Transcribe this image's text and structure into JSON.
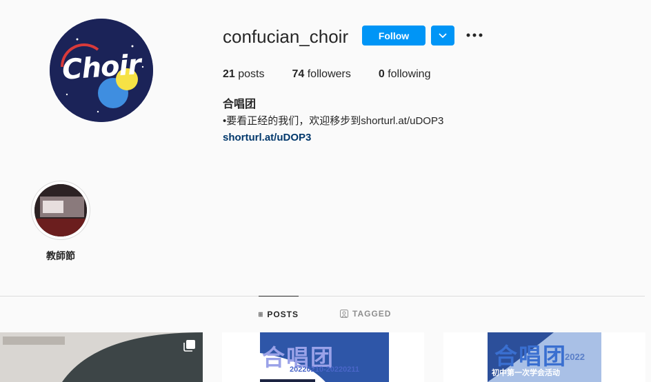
{
  "profile": {
    "avatar_text": "Choir",
    "username": "confucian_choir",
    "follow_label": "Follow",
    "stats": {
      "posts_count": "21",
      "posts_label": " posts",
      "followers_count": "74",
      "followers_label": " followers",
      "following_count": "0",
      "following_label": " following"
    },
    "bio_name": "合唱团",
    "bio_text": "•要看正经的我们，欢迎移步到shorturl.at/uDOP3",
    "bio_link": "shorturl.at/uDOP3"
  },
  "highlights": [
    {
      "label": "教師節"
    }
  ],
  "tabs": [
    {
      "label": "POSTS",
      "icon": "grid-icon",
      "active": true
    },
    {
      "label": "TAGGED",
      "icon": "tag-user-icon",
      "active": false
    }
  ],
  "posts": [
    {
      "type": "multi",
      "title": "",
      "subtitle": ""
    },
    {
      "type": "single",
      "title": "合唱团",
      "subtitle": "20220210-20220211"
    },
    {
      "type": "single",
      "title": "合唱团",
      "title_suffix": "2022",
      "subtitle": "初中第一次学会活动"
    }
  ],
  "colors": {
    "accent": "#0095f6",
    "link": "#00376b",
    "avatar_bg": "#1b2358",
    "text": "#262626",
    "muted": "#8e8e8e",
    "border": "#dbdbdb"
  }
}
